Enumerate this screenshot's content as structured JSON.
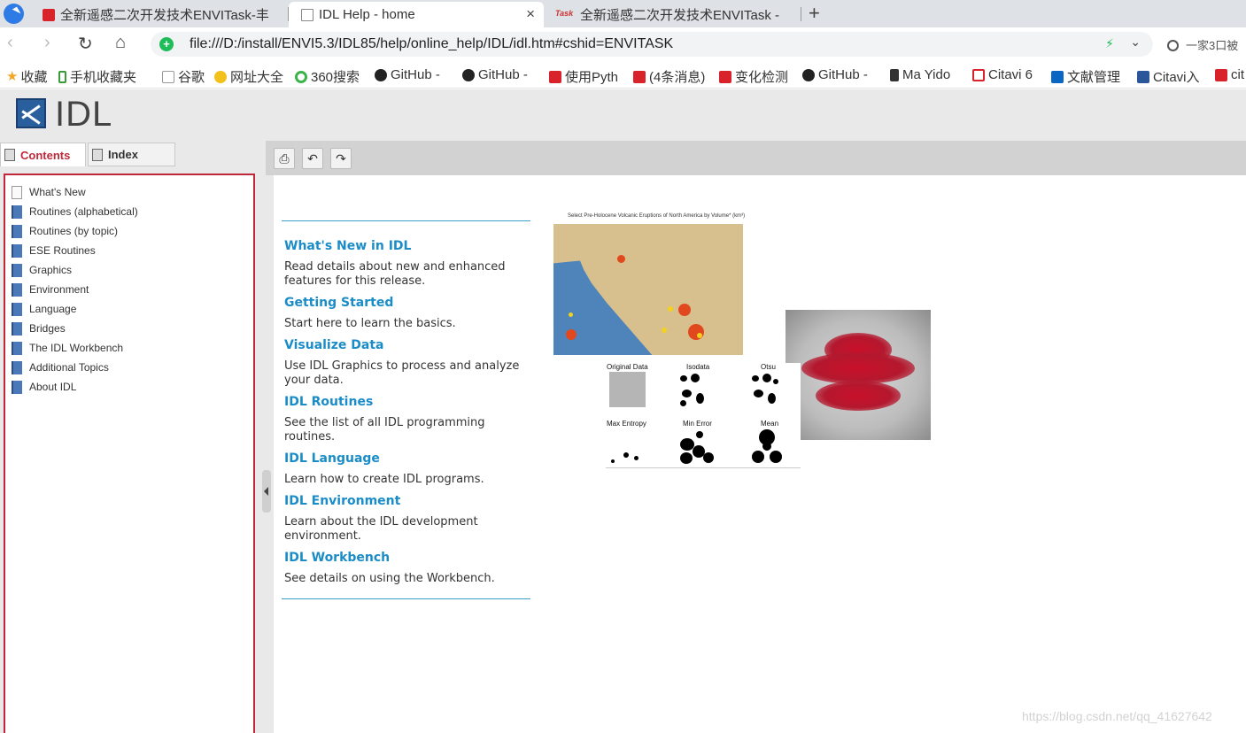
{
  "browser": {
    "tabs": [
      {
        "title": "全新遥感二次开发技术ENVITask-丰",
        "active": false
      },
      {
        "title": "IDL Help - home",
        "active": true
      },
      {
        "title": "全新遥感二次开发技术ENVITask -",
        "active": false
      }
    ],
    "task_favicon_text": "Task",
    "close_tab_glyph": "×",
    "new_tab_glyph": "+",
    "url": "file:///D:/install/ENVI5.3/IDL85/help/online_help/IDL/idl.htm#cshid=ENVITASK",
    "search_placeholder": "一家3口被",
    "bookmarks": [
      {
        "label": "收藏",
        "icon": "star-icon"
      },
      {
        "label": "手机收藏夹",
        "icon": "phone-icon"
      },
      {
        "label": "谷歌",
        "icon": "doc-icon"
      },
      {
        "label": "网址大全",
        "icon": "globe-icon"
      },
      {
        "label": "360搜索",
        "icon": "360-icon"
      },
      {
        "label": "GitHub -",
        "icon": "github-icon"
      },
      {
        "label": "GitHub -",
        "icon": "github-icon"
      },
      {
        "label": "使用Pyth",
        "icon": "csdn-icon"
      },
      {
        "label": "(4条消息)",
        "icon": "csdn-icon"
      },
      {
        "label": "变化检测",
        "icon": "csdn-icon"
      },
      {
        "label": "GitHub -",
        "icon": "github-icon"
      },
      {
        "label": "Ma Yido",
        "icon": "ma-icon"
      },
      {
        "label": "Citavi 6",
        "icon": "citavi-icon"
      },
      {
        "label": "文献管理",
        "icon": "zhihu-icon"
      },
      {
        "label": "Citavi入",
        "icon": "word-icon"
      },
      {
        "label": "cit",
        "icon": "csdn-icon"
      }
    ]
  },
  "idl": {
    "title": "IDL",
    "panel_tabs": {
      "contents": "Contents",
      "index": "Index"
    },
    "toc": [
      {
        "label": "What's New",
        "icon": "page-icon"
      },
      {
        "label": "Routines (alphabetical)",
        "icon": "book-icon"
      },
      {
        "label": "Routines (by topic)",
        "icon": "book-icon"
      },
      {
        "label": "ESE Routines",
        "icon": "book-icon"
      },
      {
        "label": "Graphics",
        "icon": "book-icon"
      },
      {
        "label": "Environment",
        "icon": "book-icon"
      },
      {
        "label": "Language",
        "icon": "book-icon"
      },
      {
        "label": "Bridges",
        "icon": "book-icon"
      },
      {
        "label": "The IDL Workbench",
        "icon": "book-icon"
      },
      {
        "label": "Additional Topics",
        "icon": "book-icon"
      },
      {
        "label": "About IDL",
        "icon": "book-icon"
      }
    ],
    "toolbar": [
      "print-icon",
      "back-icon",
      "forward-icon"
    ],
    "links": [
      {
        "title": "What's New in IDL",
        "desc": "Read details about new and enhanced features for this release."
      },
      {
        "title": "Getting Started",
        "desc": "Start here to learn the basics."
      },
      {
        "title": "Visualize Data",
        "desc": "Use IDL Graphics to process and analyze your data."
      },
      {
        "title": "IDL Routines",
        "desc": "See the list of all IDL programming routines."
      },
      {
        "title": "IDL Language",
        "desc": "Learn how to create IDL programs."
      },
      {
        "title": "IDL Environment",
        "desc": "Learn about the IDL development environment."
      },
      {
        "title": "IDL Workbench",
        "desc": "See details on using the Workbench."
      }
    ],
    "map_caption": "Select Pre-Holocene Volcanic Eruptions of North America by Volume* (km³)",
    "threshold_labels": [
      "Original Data",
      "Isodata",
      "Otsu",
      "Max Entropy",
      "Min Error",
      "Mean"
    ]
  },
  "watermark": "https://blog.csdn.net/qq_41627642",
  "colors": {
    "accent_red": "#c0283a",
    "link_blue": "#1a8cc8",
    "rule_blue": "#3d9fc7"
  }
}
